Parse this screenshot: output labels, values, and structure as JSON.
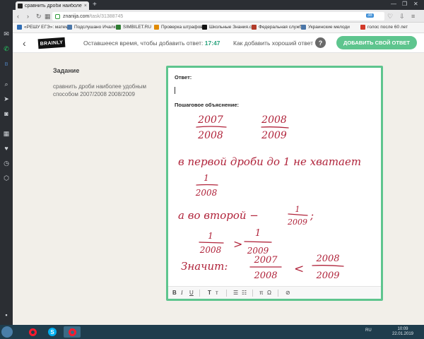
{
  "browser": {
    "tab_title": "сравнить дроби наиболе",
    "tab_close": "×",
    "new_tab": "+",
    "url_domain": "znanija.com",
    "url_path": "/task/31388745",
    "badge": "38",
    "window_controls": [
      "—",
      "❐",
      "✕"
    ]
  },
  "bookmarks": [
    {
      "label": "«РЕШУ ЕГЭ»: матем",
      "color": "#2f6db5"
    },
    {
      "label": "Подслушано Ичалки",
      "color": "#4a76a8"
    },
    {
      "label": "SIMBILET.RU",
      "color": "#2e7d32"
    },
    {
      "label": "Проверка штрафов",
      "color": "#e08a00"
    },
    {
      "label": "Школьные Знания.c",
      "color": "#111111"
    },
    {
      "label": "Федеральная служб",
      "color": "#b23b2a"
    },
    {
      "label": "Украинские мелоди",
      "color": "#4a76a8"
    },
    {
      "label": "голос после 60 лет",
      "color": "#d23a2a"
    }
  ],
  "header": {
    "logo": "BRAINLY",
    "timer_label": "Оставшееся время, чтобы добавить ответ:",
    "timer_value": "17:47",
    "howto": "Как добавить хороший ответ",
    "help": "?",
    "add_button": "ДОБАВИТЬ СВОЙ ОТВЕТ"
  },
  "task": {
    "heading": "Задание",
    "text": "сравнить дроби наиболее удобным способом 2007/2008 2008/2009"
  },
  "answer": {
    "label": "Ответ:",
    "step_label": "Пошаговое объяснение:",
    "handwriting": {
      "frac1_num": "2007",
      "frac1_den": "2008",
      "frac2_num": "2008",
      "frac2_den": "2009",
      "line2": "в первой дроби до 1 не хватает",
      "frac3_num": "1",
      "frac3_den": "2008",
      "line3": "а во второй −",
      "frac4_num": "1",
      "frac4_den": "2009",
      "line3_end": ";",
      "frac5_num": "1",
      "frac5_den": "2008",
      "gt": ">",
      "frac6_num": "1",
      "frac6_den": "2009",
      "line5": "Значит:",
      "frac7_num": "2007",
      "frac7_den": "2008",
      "lt": "<",
      "frac8_num": "2008",
      "frac8_den": "2009"
    },
    "ink_color": "#b0233a"
  },
  "toolbar": {
    "bold": "B",
    "italic": "I",
    "underline": "U",
    "t1": "T",
    "t2": "т",
    "ol": "☰",
    "ul": "☷",
    "pi": "π",
    "omega": "Ω",
    "attach": "⊘"
  },
  "taskbar": {
    "lang": "RU",
    "time": "10:09",
    "date": "22.01.2019"
  }
}
